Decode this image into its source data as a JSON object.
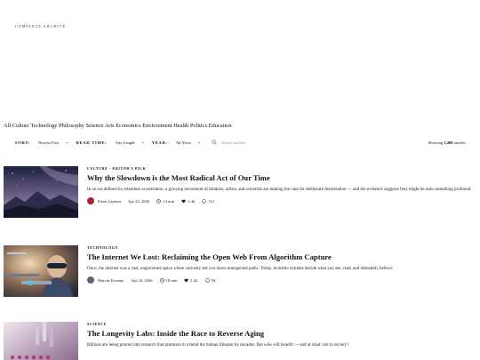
{
  "header": {
    "eyebrow": "COMPLETE ARCHIVE"
  },
  "categories": [
    "All",
    "Culture",
    "Technology",
    "Philosophy",
    "Science",
    "Arts",
    "Economics",
    "Environment",
    "Health",
    "Politics",
    "Education"
  ],
  "filters": {
    "sort_label": "SORT:",
    "sort_value": "Newest First",
    "read_label": "READ TIME:",
    "read_value": "Any Length",
    "year_label": "YEAR:",
    "year_value": "All Years",
    "search_placeholder": "Search archive...",
    "showing_prefix": "Showing",
    "showing_count": "1,400",
    "showing_suffix": "articles"
  },
  "articles": [
    {
      "kicker": "CULTURE · EDITOR'S PICK",
      "title": "Why the Slowdown is the Most Radical Act of Our Time",
      "excerpt": "In an era defined by relentless acceleration, a growing movement of thinkers, artists, and scientists are making the case for deliberate deceleration — and the evidence suggests they might be onto something profound.",
      "author": "Elena Laurent",
      "date": "Apr 22, 2026",
      "read_time": "14 min",
      "likes": "1.4k",
      "comments": "112",
      "image_icon": "night-sky-mountains-image",
      "avatar_color": "#a3242f"
    },
    {
      "kicker": "TECHNOLOGY",
      "title": "The Internet We Lost: Reclaiming the Open Web From Algorithm Capture",
      "excerpt": "Once, the internet was a vast, ungoverned space where curiosity led you down unexpected paths. Today, invisible systems decide what you see, read, and ultimately believe.",
      "author": "Marcus Kwame",
      "date": "Apr 24, 2026",
      "read_time": "18 min",
      "likes": "1.2k",
      "comments": "94",
      "image_icon": "lab-scientist-image",
      "avatar_color": "#6b5c78"
    },
    {
      "kicker": "SCIENCE",
      "title": "The Longevity Labs: Inside the Race to Reverse Aging",
      "excerpt": "Billions are being poured into research that promises to extend the human lifespan by decades. But who will benefit — and at what cost to society?",
      "image_icon": "pipette-samples-image"
    }
  ]
}
